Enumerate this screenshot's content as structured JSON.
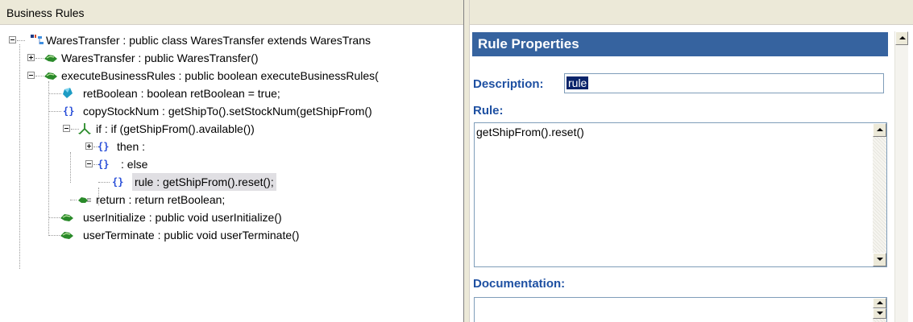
{
  "left_panel": {
    "title": "Business Rules"
  },
  "tree": [
    {
      "label": "WaresTransfer : public class WaresTransfer extends WaresTrans",
      "icon": "class-icon",
      "expander": "minus"
    },
    {
      "label": "WaresTransfer : public  WaresTransfer()",
      "icon": "method-icon",
      "expander": "plus"
    },
    {
      "label": "executeBusinessRules : public boolean executeBusinessRules(",
      "icon": "method-icon",
      "expander": "minus"
    },
    {
      "label": "retBoolean : boolean retBoolean = true;",
      "icon": "variable-icon",
      "expander": "none"
    },
    {
      "label": "copyStockNum : getShipTo().setStockNum(getShipFrom()",
      "icon": "braces-icon",
      "expander": "none"
    },
    {
      "label": "if : if (getShipFrom().available())",
      "icon": "branch-icon",
      "expander": "minus"
    },
    {
      "label": "then :",
      "icon": "braces-icon",
      "expander": "plus"
    },
    {
      "label": ": else",
      "icon": "braces-icon",
      "expander": "minus"
    },
    {
      "label": "rule : getShipFrom().reset();",
      "icon": "braces-icon",
      "expander": "none",
      "selected": true
    },
    {
      "label": "return : return retBoolean;",
      "icon": "return-icon",
      "expander": "none"
    },
    {
      "label": "userInitialize : public void userInitialize()",
      "icon": "method-icon",
      "expander": "none"
    },
    {
      "label": "userTerminate : public void userTerminate()",
      "icon": "method-icon",
      "expander": "none"
    }
  ],
  "properties": {
    "title": "Rule Properties",
    "description_label": "Description:",
    "description_value": "rule",
    "rule_label": "Rule:",
    "rule_value": "getShipFrom().reset()",
    "documentation_label": "Documentation:",
    "documentation_value": ""
  },
  "colors": {
    "title_bar": "#36639f",
    "field_label": "#1e50a2",
    "method_icon": "#2a8a2a",
    "braces_icon": "#2a4fd8",
    "variable_icon": "#1d9cc4"
  }
}
